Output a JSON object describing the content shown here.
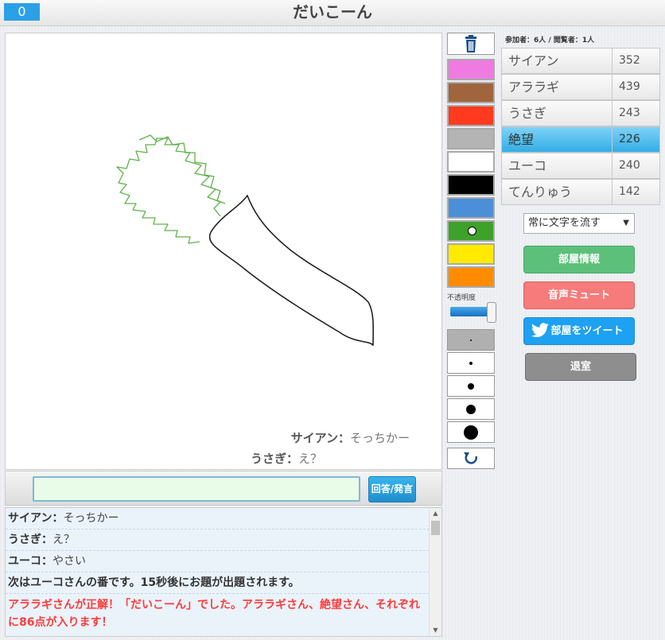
{
  "header": {
    "timer": "0",
    "title": "だいこーん"
  },
  "canvas": {
    "overlay_chat": [
      {
        "name": "サイアン：",
        "message": "そっちかー"
      },
      {
        "name": "うさぎ：",
        "message": "え？"
      }
    ]
  },
  "input": {
    "value": "",
    "submit_label": "回答/発言"
  },
  "log": {
    "lines": [
      {
        "name": "サイアン：",
        "message": "そっちかー"
      },
      {
        "name": "うさぎ：",
        "message": "え？"
      },
      {
        "name": "ユーコ：",
        "message": "やさい"
      }
    ],
    "system_message": "次はユーコさんの番です。15秒後にお題が出題されます。",
    "correct_message": "アララギさんが正解！「だいこーん」でした。アララギさん、絶望さん、それぞれに86点が入ります！"
  },
  "palette": {
    "colors": [
      "#ef7ae0",
      "#a0653c",
      "#ff3a1f",
      "#b4b4b4",
      "#ffffff",
      "#000000",
      "#4b8fd8",
      "#3ea12a",
      "#ffea00",
      "#ff8c00"
    ],
    "selected_index": 7,
    "opacity_label": "不透明度",
    "opacity_value": 1.0,
    "brush_sizes": [
      2,
      4,
      8,
      12,
      18
    ],
    "selected_size_index": 0
  },
  "sidebar": {
    "participants": "参加者：6人 / 閲覧者：1人",
    "players": [
      {
        "name": "サイアン",
        "score": "352",
        "active": false
      },
      {
        "name": "アララギ",
        "score": "439",
        "active": false
      },
      {
        "name": "うさぎ",
        "score": "243",
        "active": false
      },
      {
        "name": "絶望",
        "score": "226",
        "active": true
      },
      {
        "name": "ユーコ",
        "score": "240",
        "active": false
      },
      {
        "name": "てんりゅう",
        "score": "142",
        "active": false
      }
    ],
    "text_flow_option": "常に文字を流す",
    "room_info_label": "部屋情報",
    "mute_label": "音声ミュート",
    "tweet_label": "部屋をツイート",
    "leave_label": "退室"
  },
  "icons": {
    "trash": "trash-icon",
    "undo": "undo-icon",
    "twitter": "twitter-bird-icon",
    "dropdown": "chevron-down-icon"
  }
}
